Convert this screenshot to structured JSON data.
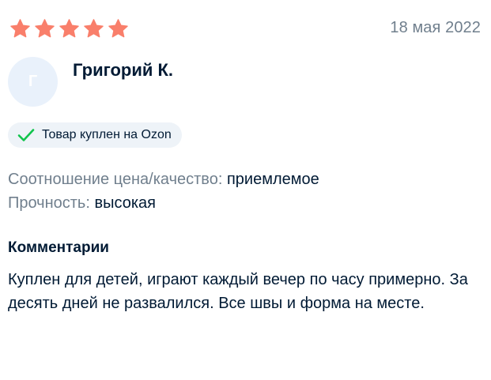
{
  "review": {
    "rating": 5,
    "rating_max": 5,
    "star_color": "#f97f6b",
    "date": "18 мая 2022",
    "avatar_letter": "Г",
    "author": "Григорий К.",
    "badge": {
      "icon": "check-icon",
      "icon_color": "#10c44c",
      "text": "Товар куплен на Ozon"
    },
    "properties": [
      {
        "label": "Соотношение цена/качество:",
        "value": "приемлемое"
      },
      {
        "label": "Прочность:",
        "value": "высокая"
      }
    ],
    "comment_title": "Комментарии",
    "comment_text": "Куплен для детей, играют каждый вечер по часу примерно. За десять дней не развалился. Все швы и форма на месте."
  }
}
